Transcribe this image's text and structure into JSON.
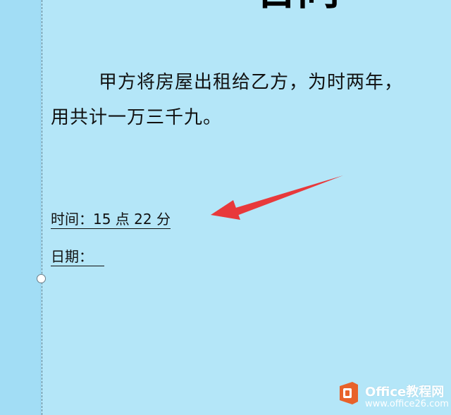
{
  "document": {
    "title_fragment": "合同",
    "paragraph_line1": "甲方将房屋出租给乙方，为时两年，",
    "paragraph_line2": "用共计一万三千九。",
    "time_field": "时间：15 点 22 分",
    "date_field": "日期："
  },
  "annotation": {
    "arrow_color": "#e8393b"
  },
  "watermark": {
    "brand": "Office教程网",
    "url": "www.office26.com",
    "logo_color": "#e8622a"
  },
  "colors": {
    "page_background": "#b4e6f8",
    "margin_background": "#a2ddf5"
  }
}
